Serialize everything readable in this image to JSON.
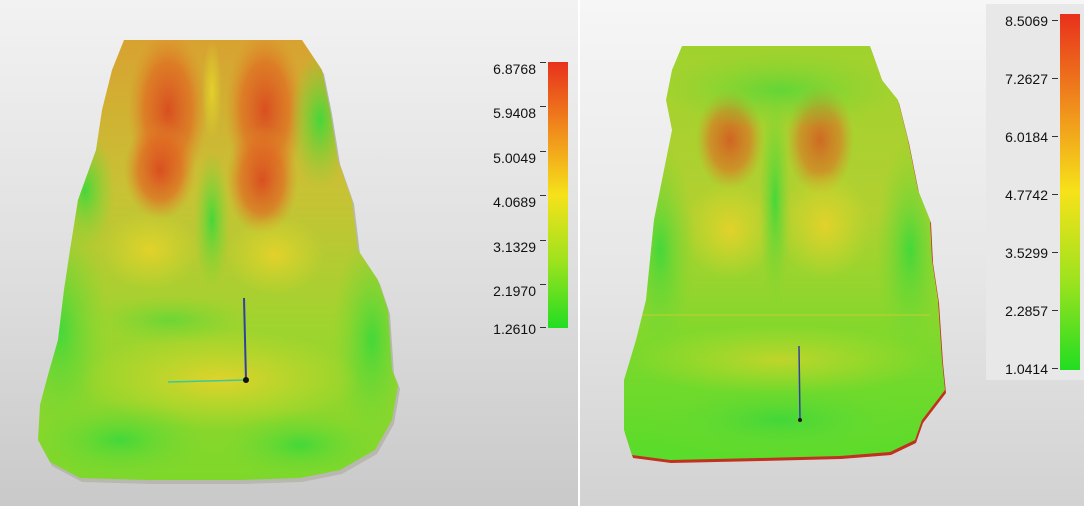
{
  "left_scale": {
    "labels": [
      "6.8768",
      "5.9408",
      "5.0049",
      "4.0689",
      "3.1329",
      "2.1970",
      "1.2610"
    ]
  },
  "right_scale": {
    "labels": [
      "8.5069",
      "7.2627",
      "6.0184",
      "4.7742",
      "3.5299",
      "2.2857",
      "1.0414"
    ]
  },
  "colors": {
    "high": "#e8301c",
    "mid_high": "#f08a1c",
    "mid": "#f6e21a",
    "mid_low": "#9ee21e",
    "low": "#22dd22"
  }
}
